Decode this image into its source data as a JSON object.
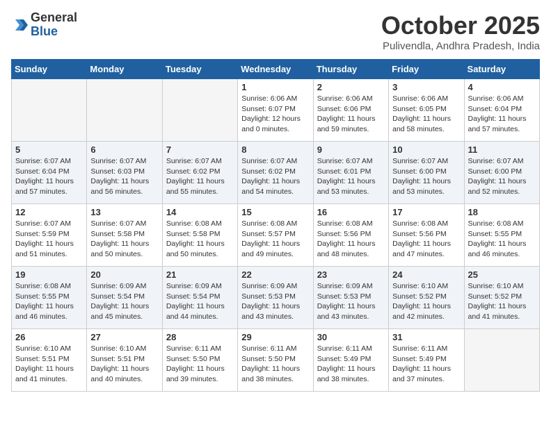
{
  "header": {
    "logo_general": "General",
    "logo_blue": "Blue",
    "month_title": "October 2025",
    "location": "Pulivendla, Andhra Pradesh, India"
  },
  "weekdays": [
    "Sunday",
    "Monday",
    "Tuesday",
    "Wednesday",
    "Thursday",
    "Friday",
    "Saturday"
  ],
  "weeks": [
    [
      {
        "day": "",
        "sunrise": "",
        "sunset": "",
        "daylight": ""
      },
      {
        "day": "",
        "sunrise": "",
        "sunset": "",
        "daylight": ""
      },
      {
        "day": "",
        "sunrise": "",
        "sunset": "",
        "daylight": ""
      },
      {
        "day": "1",
        "sunrise": "Sunrise: 6:06 AM",
        "sunset": "Sunset: 6:07 PM",
        "daylight": "Daylight: 12 hours and 0 minutes."
      },
      {
        "day": "2",
        "sunrise": "Sunrise: 6:06 AM",
        "sunset": "Sunset: 6:06 PM",
        "daylight": "Daylight: 11 hours and 59 minutes."
      },
      {
        "day": "3",
        "sunrise": "Sunrise: 6:06 AM",
        "sunset": "Sunset: 6:05 PM",
        "daylight": "Daylight: 11 hours and 58 minutes."
      },
      {
        "day": "4",
        "sunrise": "Sunrise: 6:06 AM",
        "sunset": "Sunset: 6:04 PM",
        "daylight": "Daylight: 11 hours and 57 minutes."
      }
    ],
    [
      {
        "day": "5",
        "sunrise": "Sunrise: 6:07 AM",
        "sunset": "Sunset: 6:04 PM",
        "daylight": "Daylight: 11 hours and 57 minutes."
      },
      {
        "day": "6",
        "sunrise": "Sunrise: 6:07 AM",
        "sunset": "Sunset: 6:03 PM",
        "daylight": "Daylight: 11 hours and 56 minutes."
      },
      {
        "day": "7",
        "sunrise": "Sunrise: 6:07 AM",
        "sunset": "Sunset: 6:02 PM",
        "daylight": "Daylight: 11 hours and 55 minutes."
      },
      {
        "day": "8",
        "sunrise": "Sunrise: 6:07 AM",
        "sunset": "Sunset: 6:02 PM",
        "daylight": "Daylight: 11 hours and 54 minutes."
      },
      {
        "day": "9",
        "sunrise": "Sunrise: 6:07 AM",
        "sunset": "Sunset: 6:01 PM",
        "daylight": "Daylight: 11 hours and 53 minutes."
      },
      {
        "day": "10",
        "sunrise": "Sunrise: 6:07 AM",
        "sunset": "Sunset: 6:00 PM",
        "daylight": "Daylight: 11 hours and 53 minutes."
      },
      {
        "day": "11",
        "sunrise": "Sunrise: 6:07 AM",
        "sunset": "Sunset: 6:00 PM",
        "daylight": "Daylight: 11 hours and 52 minutes."
      }
    ],
    [
      {
        "day": "12",
        "sunrise": "Sunrise: 6:07 AM",
        "sunset": "Sunset: 5:59 PM",
        "daylight": "Daylight: 11 hours and 51 minutes."
      },
      {
        "day": "13",
        "sunrise": "Sunrise: 6:07 AM",
        "sunset": "Sunset: 5:58 PM",
        "daylight": "Daylight: 11 hours and 50 minutes."
      },
      {
        "day": "14",
        "sunrise": "Sunrise: 6:08 AM",
        "sunset": "Sunset: 5:58 PM",
        "daylight": "Daylight: 11 hours and 50 minutes."
      },
      {
        "day": "15",
        "sunrise": "Sunrise: 6:08 AM",
        "sunset": "Sunset: 5:57 PM",
        "daylight": "Daylight: 11 hours and 49 minutes."
      },
      {
        "day": "16",
        "sunrise": "Sunrise: 6:08 AM",
        "sunset": "Sunset: 5:56 PM",
        "daylight": "Daylight: 11 hours and 48 minutes."
      },
      {
        "day": "17",
        "sunrise": "Sunrise: 6:08 AM",
        "sunset": "Sunset: 5:56 PM",
        "daylight": "Daylight: 11 hours and 47 minutes."
      },
      {
        "day": "18",
        "sunrise": "Sunrise: 6:08 AM",
        "sunset": "Sunset: 5:55 PM",
        "daylight": "Daylight: 11 hours and 46 minutes."
      }
    ],
    [
      {
        "day": "19",
        "sunrise": "Sunrise: 6:08 AM",
        "sunset": "Sunset: 5:55 PM",
        "daylight": "Daylight: 11 hours and 46 minutes."
      },
      {
        "day": "20",
        "sunrise": "Sunrise: 6:09 AM",
        "sunset": "Sunset: 5:54 PM",
        "daylight": "Daylight: 11 hours and 45 minutes."
      },
      {
        "day": "21",
        "sunrise": "Sunrise: 6:09 AM",
        "sunset": "Sunset: 5:54 PM",
        "daylight": "Daylight: 11 hours and 44 minutes."
      },
      {
        "day": "22",
        "sunrise": "Sunrise: 6:09 AM",
        "sunset": "Sunset: 5:53 PM",
        "daylight": "Daylight: 11 hours and 43 minutes."
      },
      {
        "day": "23",
        "sunrise": "Sunrise: 6:09 AM",
        "sunset": "Sunset: 5:53 PM",
        "daylight": "Daylight: 11 hours and 43 minutes."
      },
      {
        "day": "24",
        "sunrise": "Sunrise: 6:10 AM",
        "sunset": "Sunset: 5:52 PM",
        "daylight": "Daylight: 11 hours and 42 minutes."
      },
      {
        "day": "25",
        "sunrise": "Sunrise: 6:10 AM",
        "sunset": "Sunset: 5:52 PM",
        "daylight": "Daylight: 11 hours and 41 minutes."
      }
    ],
    [
      {
        "day": "26",
        "sunrise": "Sunrise: 6:10 AM",
        "sunset": "Sunset: 5:51 PM",
        "daylight": "Daylight: 11 hours and 41 minutes."
      },
      {
        "day": "27",
        "sunrise": "Sunrise: 6:10 AM",
        "sunset": "Sunset: 5:51 PM",
        "daylight": "Daylight: 11 hours and 40 minutes."
      },
      {
        "day": "28",
        "sunrise": "Sunrise: 6:11 AM",
        "sunset": "Sunset: 5:50 PM",
        "daylight": "Daylight: 11 hours and 39 minutes."
      },
      {
        "day": "29",
        "sunrise": "Sunrise: 6:11 AM",
        "sunset": "Sunset: 5:50 PM",
        "daylight": "Daylight: 11 hours and 38 minutes."
      },
      {
        "day": "30",
        "sunrise": "Sunrise: 6:11 AM",
        "sunset": "Sunset: 5:49 PM",
        "daylight": "Daylight: 11 hours and 38 minutes."
      },
      {
        "day": "31",
        "sunrise": "Sunrise: 6:11 AM",
        "sunset": "Sunset: 5:49 PM",
        "daylight": "Daylight: 11 hours and 37 minutes."
      },
      {
        "day": "",
        "sunrise": "",
        "sunset": "",
        "daylight": ""
      }
    ]
  ]
}
